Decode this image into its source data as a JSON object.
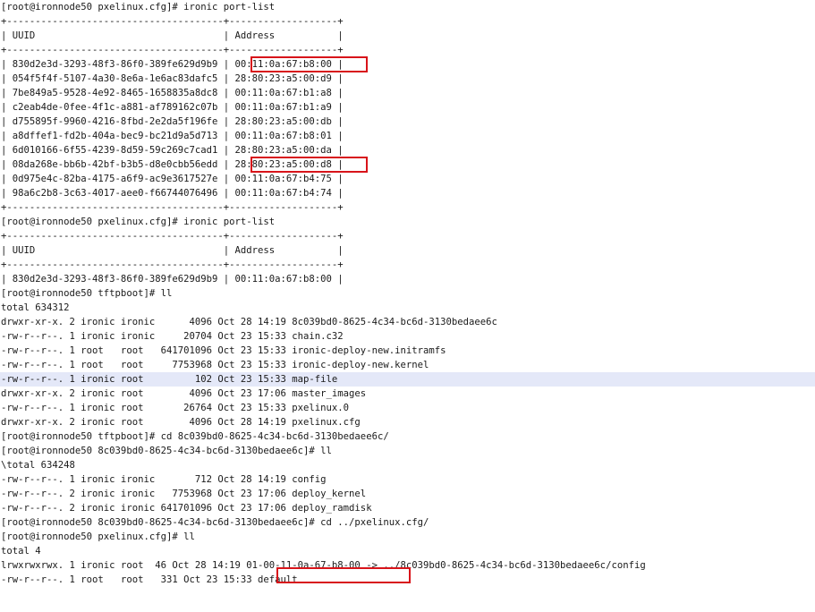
{
  "terminal": {
    "lines": [
      "[root@ironnode50 pxelinux.cfg]# ironic port-list",
      "+--------------------------------------+-------------------+",
      "| UUID                                 | Address           |",
      "+--------------------------------------+-------------------+",
      "| 830d2e3d-3293-48f3-86f0-389fe629d9b9 | 00:11:0a:67:b8:00 |",
      "| 054f5f4f-5107-4a30-8e6a-1e6ac83dafc5 | 28:80:23:a5:00:d9 |",
      "| 7be849a5-9528-4e92-8465-1658835a8dc8 | 00:11:0a:67:b1:a8 |",
      "| c2eab4de-0fee-4f1c-a881-af789162c07b | 00:11:0a:67:b1:a9 |",
      "| d755895f-9960-4216-8fbd-2e2da5f196fe | 28:80:23:a5:00:db |",
      "| a8dffef1-fd2b-404a-bec9-bc21d9a5d713 | 00:11:0a:67:b8:01 |",
      "| 6d010166-6f55-4239-8d59-59c269c7cad1 | 28:80:23:a5:00:da |",
      "| 08da268e-bb6b-42bf-b3b5-d8e0cbb56edd | 28:80:23:a5:00:d8 |",
      "| 0d975e4c-82ba-4175-a6f9-ac9e3617527e | 00:11:0a:67:b4:75 |",
      "| 98a6c2b8-3c63-4017-aee0-f66744076496 | 00:11:0a:67:b4:74 |",
      "+--------------------------------------+-------------------+",
      "[root@ironnode50 pxelinux.cfg]# ironic port-list",
      "+--------------------------------------+-------------------+",
      "| UUID                                 | Address           |",
      "+--------------------------------------+-------------------+",
      "| 830d2e3d-3293-48f3-86f0-389fe629d9b9 | 00:11:0a:67:b8:00 |",
      "[root@ironnode50 tftpboot]# ll",
      "total 634312",
      "drwxr-xr-x. 2 ironic ironic      4096 Oct 28 14:19 8c039bd0-8625-4c34-bc6d-3130bedaee6c",
      "-rw-r--r--. 1 ironic ironic     20704 Oct 23 15:33 chain.c32",
      "-rw-r--r--. 1 root   root   641701096 Oct 23 15:33 ironic-deploy-new.initramfs",
      "-rw-r--r--. 1 root   root     7753968 Oct 23 15:33 ironic-deploy-new.kernel",
      "-rw-r--r--. 1 ironic root         102 Oct 23 15:33 map-file",
      "drwxr-xr-x. 2 ironic root        4096 Oct 23 17:06 master_images",
      "-rw-r--r--. 1 ironic root       26764 Oct 23 15:33 pxelinux.0",
      "drwxr-xr-x. 2 ironic root        4096 Oct 28 14:19 pxelinux.cfg",
      "[root@ironnode50 tftpboot]# cd 8c039bd0-8625-4c34-bc6d-3130bedaee6c/",
      "[root@ironnode50 8c039bd0-8625-4c34-bc6d-3130bedaee6c]# ll",
      "\\total 634248",
      "-rw-r--r--. 1 ironic ironic       712 Oct 28 14:19 config",
      "-rw-r--r--. 2 ironic ironic   7753968 Oct 23 17:06 deploy_kernel",
      "-rw-r--r--. 2 ironic ironic 641701096 Oct 23 17:06 deploy_ramdisk",
      "[root@ironnode50 8c039bd0-8625-4c34-bc6d-3130bedaee6c]# cd ../pxelinux.cfg/",
      "[root@ironnode50 pxelinux.cfg]# ll",
      "total 4",
      "lrwxrwxrwx. 1 ironic root  46 Oct 28 14:19 01-00-11-0a-67-b8-00 -> ../8c039bd0-8625-4c34-bc6d-3130bedaee6c/config",
      "-rw-r--r--. 1 root   root   331 Oct 23 15:33 default"
    ],
    "highlighted_line": 26,
    "annotation_color": "#d8141a",
    "highlight_color": "#e4e8f8"
  }
}
